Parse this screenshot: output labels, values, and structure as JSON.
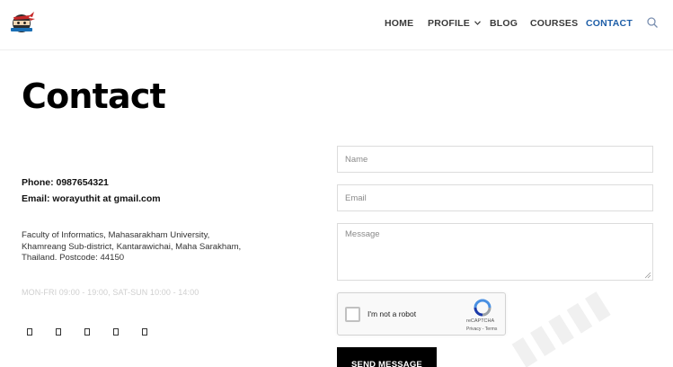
{
  "header": {
    "nav": [
      {
        "label": "HOME"
      },
      {
        "label": "PROFILE"
      },
      {
        "label": "BLOG"
      },
      {
        "label": "COURSES"
      },
      {
        "label": "CONTACT",
        "active": true
      }
    ],
    "active_color": "#1f5fa8",
    "icons": {
      "search": "search-icon",
      "profile_dropdown": "chevron-down-icon",
      "logo": "ninja-logo"
    }
  },
  "page": {
    "title": "Contact"
  },
  "contact_info": {
    "phone": "Phone: 0987654321",
    "email": "Email: worayuthit at gmail.com",
    "address_lines": [
      "Faculty of Informatics, Mahasarakham University,",
      "Khamreang Sub-district, Kantarawichai, Maha Sarakham,",
      "Thailand. Postcode: 44150"
    ],
    "hours": "MON-FRI 09:00 - 19:00, SAT-SUN 10:00 - 14:00"
  },
  "socials": [
    "social-icon-1",
    "social-icon-2",
    "social-icon-3",
    "social-icon-4",
    "social-icon-5"
  ],
  "form": {
    "name_placeholder": "Name",
    "email_placeholder": "Email",
    "message_placeholder": "Message",
    "recaptcha": {
      "label": "I'm not a robot",
      "brand": "reCAPTCHA",
      "links": "Privacy - Terms"
    },
    "submit_label": "SEND MESSAGE"
  },
  "colors": {
    "button_bg": "#000000",
    "hours_text": "#cfcfcf",
    "recaptcha_blue": "#4a90e2"
  }
}
